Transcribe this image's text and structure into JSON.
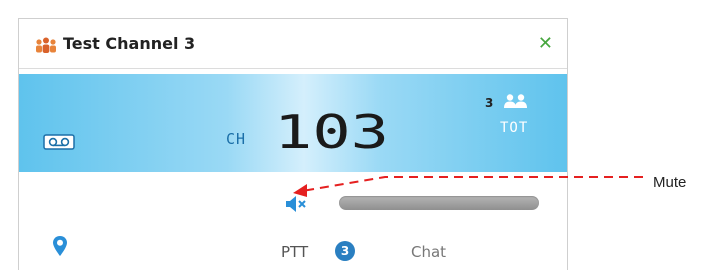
{
  "channel_window": {
    "title": "Test Channel 3",
    "close_icon": "close-icon",
    "group_icon": "group-icon",
    "colors": {
      "display_blue": "#5fc3ed",
      "close_green": "#46a63e",
      "badge_blue": "#2a7fc1",
      "digit_dark": "#1a1a1a"
    }
  },
  "display": {
    "ch_label": "CH",
    "channel_number": "103",
    "member_count": "3",
    "tot_label": "TOT",
    "voicemail_icon": "voicemail-icon",
    "members_icon": "members-icon"
  },
  "controls": {
    "mute_icon": "speaker-mute-icon",
    "location_icon": "location-pin-icon",
    "ptt_label": "PTT",
    "ptt_badge": "3",
    "chat_label": "Chat"
  },
  "annotation": {
    "label": "Mute",
    "arrow_color": "#e52020"
  }
}
